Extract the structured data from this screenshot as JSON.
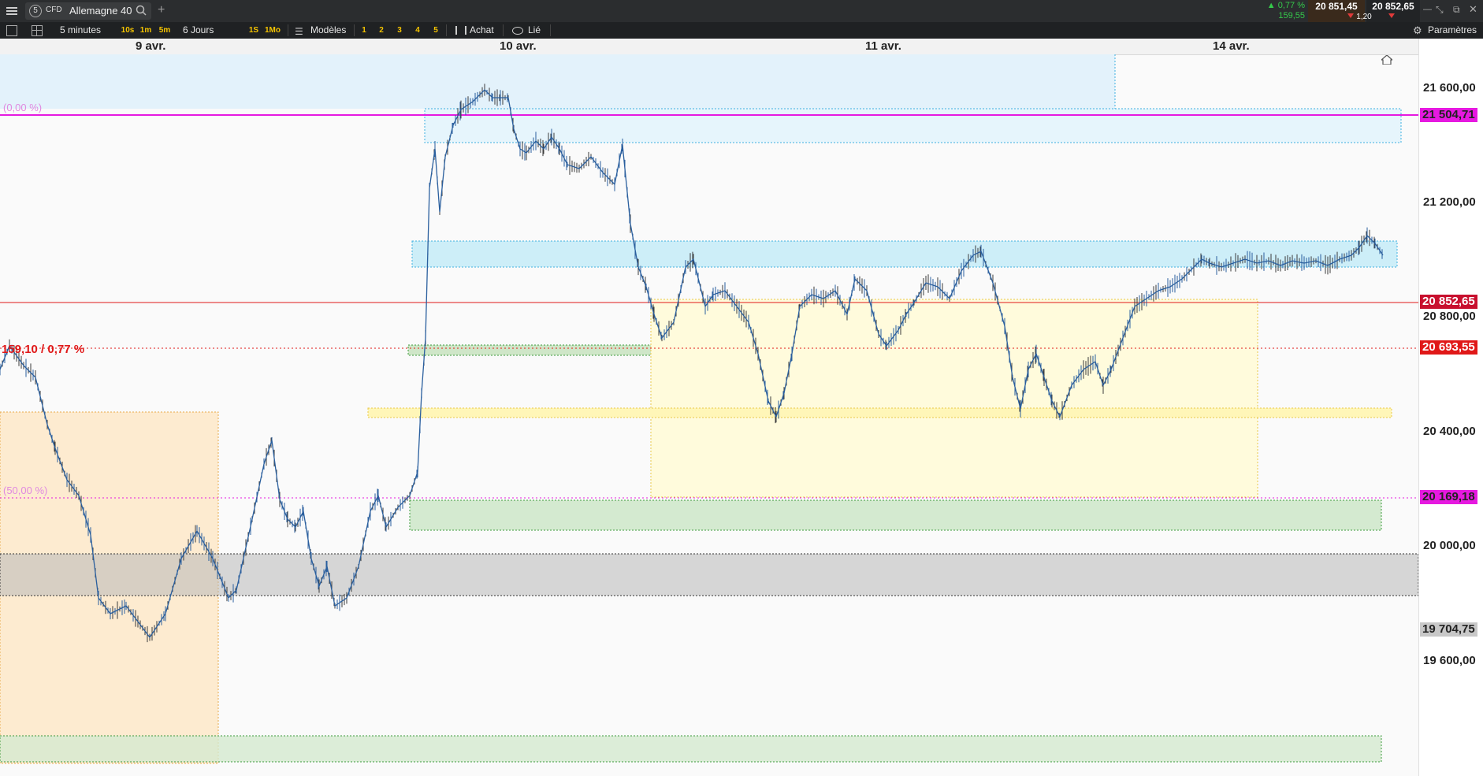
{
  "topbar": {
    "menu_icon": "hamburger-icon",
    "badge_number": "5",
    "cfd_label": "CFD",
    "instrument": "Allemagne 40",
    "add_symbol": "+",
    "change_pct": "▲ 0,77 %",
    "change_pts": "159,55",
    "bid": "20 851,45",
    "ask": "20 852,65",
    "spread": "1,20",
    "colors": {
      "positive": "#35c94a",
      "bid_bg": "#3a2a1c",
      "ask_bg": "#222426",
      "negative": "#e03a3a"
    }
  },
  "toolbar": {
    "timeframe": "5 minutes",
    "quick_timeframes": [
      "10s",
      "1m",
      "5m"
    ],
    "range": "6 Jours",
    "quick_ranges": [
      "1S",
      "1Mo"
    ],
    "templates": "Modèles",
    "layouts": [
      "1",
      "2",
      "3",
      "4",
      "5"
    ],
    "buy": "Achat",
    "linked": "Lié",
    "settings": "Paramètres"
  },
  "date_axis": [
    "9 avr.",
    "10 avr.",
    "11 avr.",
    "14 avr."
  ],
  "price_axis": {
    "ticks": [
      "21 600,00",
      "21 200,00",
      "20 800,00",
      "20 400,00",
      "20 000,00",
      "19 600,00"
    ],
    "tags": [
      {
        "label": "21 504,71",
        "color": "#e619e0",
        "text_color": "#222"
      },
      {
        "label": "20 852,65",
        "color": "#c8102e",
        "text_color": "#ffffff"
      },
      {
        "label": "20 693,55",
        "color": "#e01818",
        "text_color": "#ffffff"
      },
      {
        "label": "20 169,18",
        "color": "#e619e0",
        "text_color": "#222"
      },
      {
        "label": "19 704,75",
        "color": "#c8c8c8",
        "text_color": "#222"
      }
    ]
  },
  "chart": {
    "annotations": {
      "fib_top": "(0,00 %)",
      "fib_mid": "(50,00 %)",
      "change": "159,10 / 0,77 %"
    },
    "colors": {
      "candle": "#2a5f9e",
      "fib": "#e619e0",
      "last": "#e01818"
    }
  }
}
